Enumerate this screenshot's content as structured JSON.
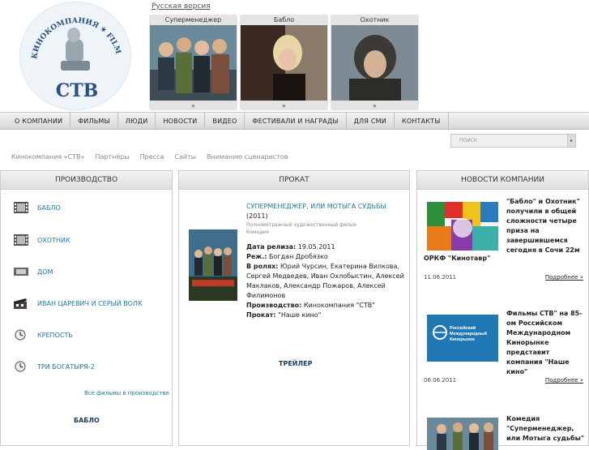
{
  "header": {
    "lang_link": "Русская версия",
    "logo_top_text": "КИНОКОМПАНИЯ ✶ FILM COMPANY",
    "logo_mark": "СТВ",
    "films": [
      {
        "title": "Суперменеджер",
        "arrow": "»"
      },
      {
        "title": "Бабло",
        "arrow": "»"
      },
      {
        "title": "Охотник",
        "arrow": "»"
      }
    ]
  },
  "nav": [
    "О КОМПАНИИ",
    "ФИЛЬМЫ",
    "ЛЮДИ",
    "НОВОСТИ",
    "ВИДЕО",
    "ФЕСТИВАЛИ И НАГРАДЫ",
    "ДЛЯ СМИ",
    "КОНТАКТЫ"
  ],
  "search": {
    "placeholder": "ПОИСК",
    "button": "▸"
  },
  "subnav": [
    "Кинокомпания «СТВ»",
    "Партнёры",
    "Пресса",
    "Сайты",
    "Вниманию сценаристов"
  ],
  "production": {
    "header": "ПРОИЗВОДСТВО",
    "items": [
      {
        "label": "БАБЛО",
        "icon": "film-strip-icon"
      },
      {
        "label": "ОХОТНИК",
        "icon": "film-strip-icon"
      },
      {
        "label": "ДОМ",
        "icon": "film-reel-icon"
      },
      {
        "label": "ИВАН ЦАРЕВИЧ И СЕРЫЙ ВОЛК",
        "icon": "clapperboard-icon"
      },
      {
        "label": "КРЕПОСТЬ",
        "icon": "clock-icon"
      },
      {
        "label": "ТРИ БОГАТЫРЯ-2",
        "icon": "clock-icon"
      }
    ],
    "all_link": "Все фильмы в производстве",
    "bottom_title": "БАБЛО"
  },
  "rental": {
    "header": "ПРОКАТ",
    "title": "СУПЕРМЕНЕДЖЕР, ИЛИ МОТЫГА СУДЬБЫ",
    "year": "(2011)",
    "kind": "Полнометражный художественный фильм",
    "genre": "Комедия",
    "release_label": "Дата релиза:",
    "release": "19.05.2011",
    "director_label": "Реж.:",
    "director": "Богдан Дробязко",
    "cast_label": "В ролях:",
    "cast": "Юрий Чурсин, Екатерина Вилкова, Сергей Медведев, Иван Охлобыстин, Алексей Маклаков, Александр Пожаров, Алексей Филимонов",
    "production_label": "Производство:",
    "production": "Кинокомпания \"СТВ\"",
    "distribution_label": "Прокат:",
    "distribution": "\"Наше кино\"",
    "trailer": "ТРЕЙЛЕР"
  },
  "news": {
    "header": "НОВОСТИ КОМПАНИИ",
    "items": [
      {
        "text": "\"Бабло\" и Охотник\" получили в общей сложности четыре приза на завершившемся сегодня в Сочи 22м",
        "tail": "ОРКФ \"Кинотавр\"",
        "date": "11.06.2011",
        "more": "Подробнее »"
      },
      {
        "text": "Фильмы СТВ\" на 85-ом Российском Международном Кинорынке представит компания \"Наше кино\"",
        "date": "06.06.2011",
        "more": "Подробнее »",
        "img_caption": "Российский Международный Кинорынок"
      },
      {
        "text": "Комедия \"Суперменеджер, или Мотыга судьбы\""
      }
    ]
  }
}
